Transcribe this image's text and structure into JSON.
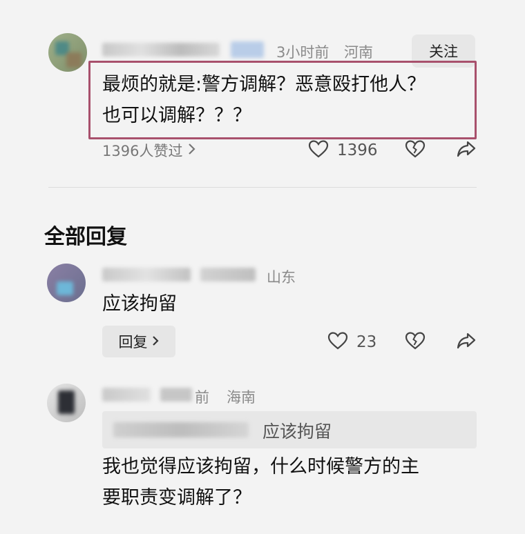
{
  "comment": {
    "time": "3小时前",
    "location": "河南",
    "follow_label": "关注",
    "text_line1": "最烦的就是:警方调解？恶意殴打他人？",
    "text_line2": "也可以调解？？？",
    "likes_link": "1396人赞过",
    "like_count": "1396"
  },
  "replies_section": {
    "title": "全部回复"
  },
  "reply1": {
    "location_partial": "山东",
    "text": "应该拘留",
    "reply_label": "回复",
    "like_count": "23"
  },
  "reply2": {
    "time_partial": "前",
    "location": "海南",
    "quoted_text": "应该拘留",
    "text_line1": "我也觉得应该拘留，什么时候警方的主",
    "text_line2": "要职责变调解了？"
  },
  "icons": {
    "like": "heart-outline-icon",
    "dislike": "broken-heart-icon",
    "share": "share-arrow-icon",
    "chevron": "chevron-right-icon"
  },
  "colors": {
    "highlight_border": "#a8506c",
    "background": "#f3f3f3",
    "meta_text": "#8a8a8a"
  }
}
